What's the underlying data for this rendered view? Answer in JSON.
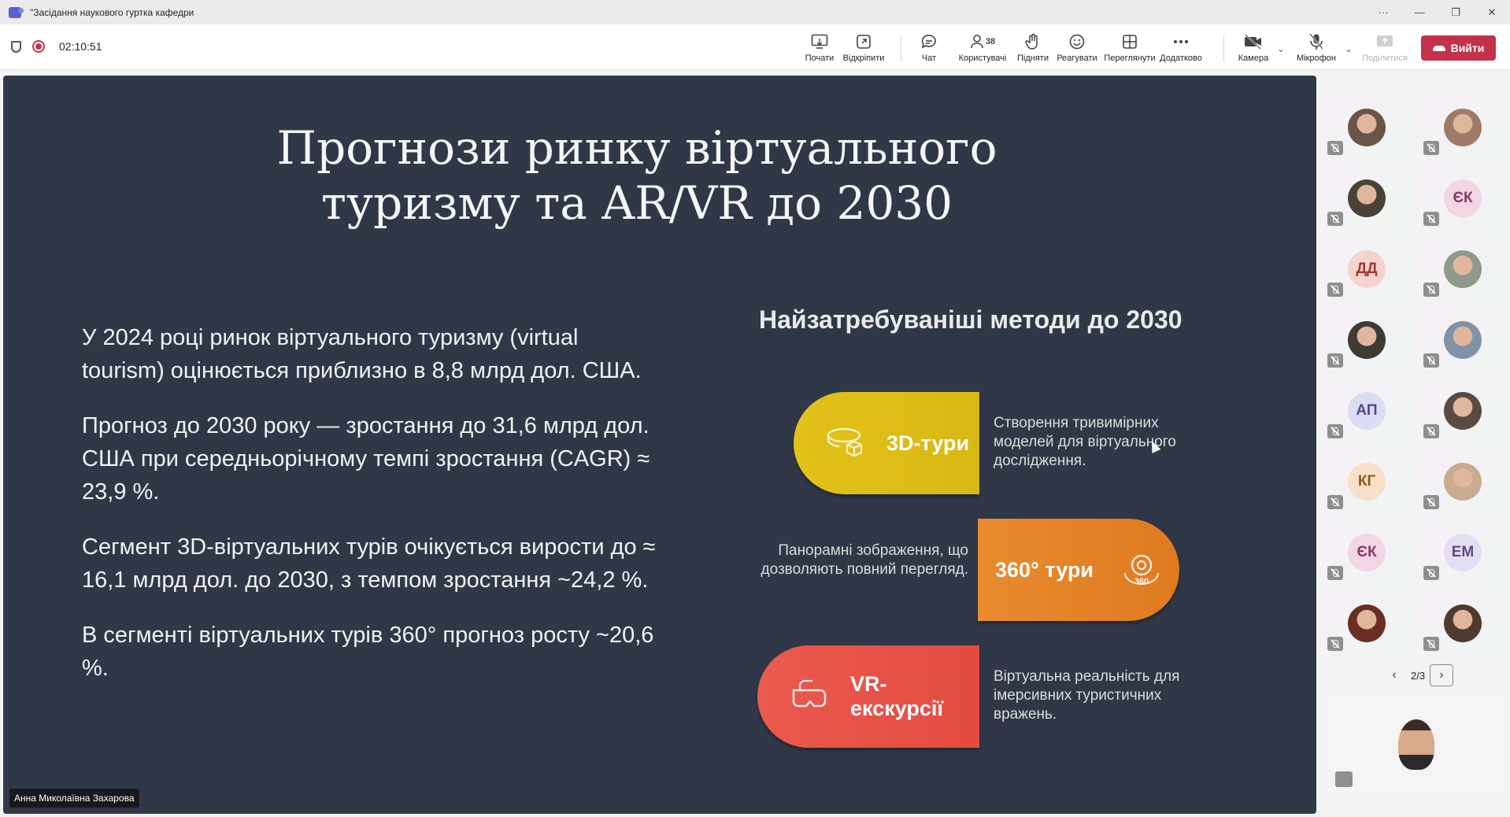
{
  "window": {
    "title": "\"Засідання наукового гуртка кафедри",
    "controls": [
      "···",
      "—",
      "❐",
      "✕"
    ]
  },
  "meeting": {
    "timer": "02:10:51"
  },
  "toolbar": {
    "start": {
      "label": "Почати",
      "icon": "screen-start-icon"
    },
    "popout": {
      "label": "Відкріпити",
      "icon": "pop-out-icon"
    },
    "chat": {
      "label": "Чат",
      "icon": "chat-icon"
    },
    "people": {
      "label": "Користувачі",
      "count": "38",
      "icon": "people-icon"
    },
    "raise": {
      "label": "Підняти",
      "icon": "raise-hand-icon"
    },
    "react": {
      "label": "Реагувати",
      "icon": "smiley-icon"
    },
    "view": {
      "label": "Переглянути",
      "icon": "grid-view-icon"
    },
    "more": {
      "label": "Додатково",
      "icon": "more-icon"
    },
    "camera": {
      "label": "Камера",
      "icon": "camera-off-icon"
    },
    "mic": {
      "label": "Мікрофон",
      "icon": "mic-off-icon"
    },
    "share": {
      "label": "Поділитися",
      "icon": "share-icon"
    },
    "leave": {
      "label": "Вийти",
      "color": "#c4314b"
    }
  },
  "slide": {
    "title_line1": "Прогнози ринку віртуального",
    "title_line2": "туризму та AR/VR до 2030",
    "bullets": [
      "У 2024 році ринок віртуального туризму (virtual tourism) оцінюється приблизно в 8,8 млрд дол. США.",
      "Прогноз до 2030 року — зростання до 31,6 млрд дол. США при середньорічному темпі зростання (CAGR) ≈ 23,9 %.",
      "Сегмент 3D-віртуальних турів очікується вирости до ≈ 16,1 млрд дол. до 2030, з темпом зростання ~24,2 %.",
      "В сегменті віртуальних турів 360° прогноз росту ~20,6 %."
    ],
    "methods_title": "Найзатребуваніші методи до 2030",
    "methods": [
      {
        "label": "3D-тури",
        "description": "Створення тривимірних моделей для віртуального дослідження.",
        "color": "#dcbc16"
      },
      {
        "label": "360° тури",
        "description": "Панорамні зображення, що дозволяють повний перегляд.",
        "color": "#e4822a"
      },
      {
        "label": "VR-екскурсії",
        "description": "Віртуальна реальність для імерсивних туристичних вражень.",
        "color": "#e65247"
      }
    ],
    "presenter": "Анна Миколаївна Захарова"
  },
  "participants": [
    {
      "type": "photo",
      "color": "#6b5448"
    },
    {
      "type": "photo",
      "color": "#a07a68"
    },
    {
      "type": "photo",
      "color": "#4a4238"
    },
    {
      "type": "initials",
      "initials": "ЄК",
      "bg": "#f2d6e4",
      "fg": "#8a3b63"
    },
    {
      "type": "initials",
      "initials": "ДД",
      "bg": "#f7d3cf",
      "fg": "#9c3a2e"
    },
    {
      "type": "photo",
      "color": "#8f9a8c"
    },
    {
      "type": "photo",
      "color": "#3e3a36"
    },
    {
      "type": "photo",
      "color": "#7f92a8"
    },
    {
      "type": "initials",
      "initials": "АП",
      "bg": "#dcdcf2",
      "fg": "#4b4b9a"
    },
    {
      "type": "photo",
      "color": "#5a4a44"
    },
    {
      "type": "initials",
      "initials": "КГ",
      "bg": "#f7e0c8",
      "fg": "#8f5a1e"
    },
    {
      "type": "photo",
      "color": "#c9ab92"
    },
    {
      "type": "initials",
      "initials": "ЄК",
      "bg": "#f2d6e4",
      "fg": "#8a3b63"
    },
    {
      "type": "initials",
      "initials": "ЕМ",
      "bg": "#e4def2",
      "fg": "#5a4a8a"
    },
    {
      "type": "photo",
      "color": "#6a2f24"
    },
    {
      "type": "photo",
      "color": "#4f3a30"
    }
  ],
  "pager": {
    "label": "2/3"
  }
}
